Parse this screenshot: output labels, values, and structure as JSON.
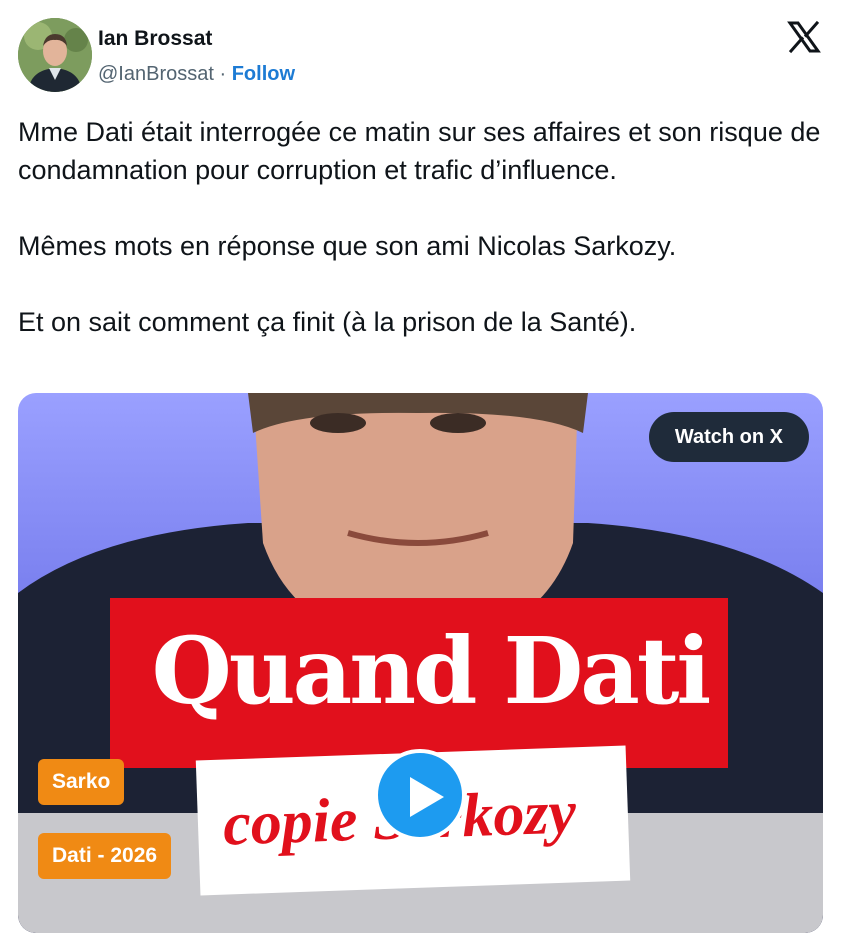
{
  "author": {
    "name": "Ian Brossat",
    "handle": "@IanBrossat",
    "separator": " · ",
    "follow_label": "Follow"
  },
  "platform_icon": "x-logo-icon",
  "tweet": {
    "text": "Mme Dati était interrogée ce matin sur ses affaires et son risque de condamnation pour corruption et trafic d’influence.\n\nMêmes mots en réponse que son ami Nicolas Sarkozy.\n\nEt on sait comment ça finit (à la prison de la Santé)."
  },
  "media": {
    "watch_label": "Watch on X",
    "title": "Quand Dati",
    "subtitle": "copie Sarkozy",
    "tags": [
      "Sarko",
      "Dati - 2026"
    ],
    "play_icon": "play-icon"
  },
  "colors": {
    "follow": "#1d7bd4",
    "banner_red": "#e1101c",
    "tag_orange": "#f08a14",
    "play_blue": "#1d9bf0",
    "watch_bg": "#1f2b3a"
  }
}
